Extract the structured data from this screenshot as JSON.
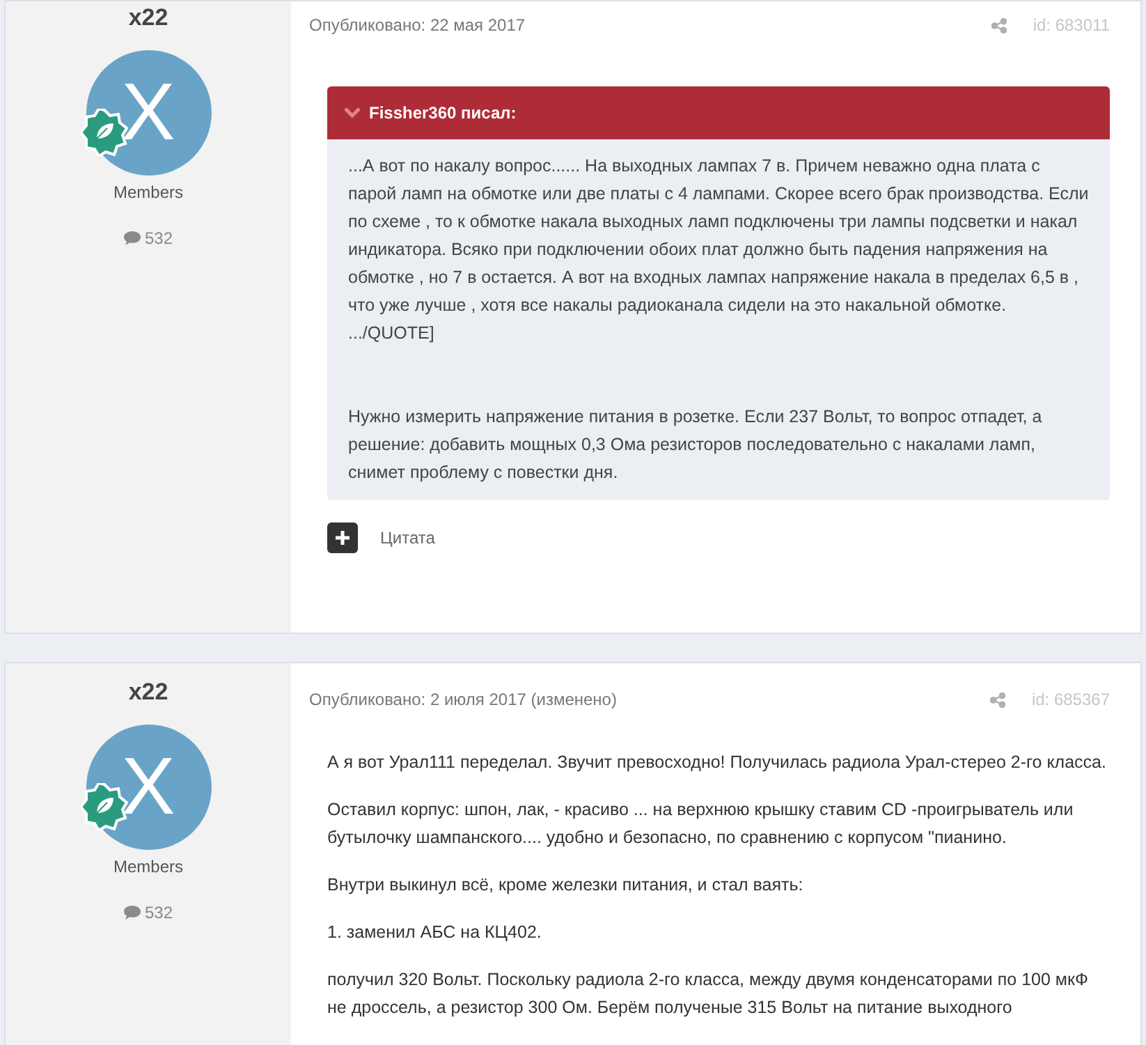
{
  "posts": [
    {
      "author": "x22",
      "avatar_letter": "X",
      "group": "Members",
      "post_count": "532",
      "published": "Опубликовано: 22 мая 2017",
      "post_id": "id: 683011",
      "quote": {
        "header": "Fissher360 писал:",
        "paragraphs": [
          "...А вот по накалу вопрос...... На выходных лампах 7 в. Причем неважно одна плата с парой ламп на обмотке или две платы с 4 лампами. Скорее всего брак производства. Если по схеме , то к обмотке накала выходных ламп подключены три лампы подсветки и накал индикатора. Всяко при подключении обоих плат должно быть падения напряжения на обмотке , но 7 в остается. А вот на входных лампах напряжение накала в пределах 6,5 в , что уже лучше , хотя все накалы радиоканала сидели на это накальной обмотке.",
          ".../QUOTE]",
          "Нужно измерить напряжение питания в розетке. Если 237 Вольт, то вопрос отпадет, а решение: добавить мощных 0,3 Ома резисторов последовательно с накалами ламп, снимет проблему с повестки дня."
        ]
      },
      "quote_action": "Цитата"
    },
    {
      "author": "x22",
      "avatar_letter": "X",
      "group": "Members",
      "post_count": "532",
      "published": "Опубликовано: 2 июля 2017 (изменено)",
      "post_id": "id: 685367",
      "paragraphs": [
        "А я вот Урал111 переделал. Звучит превосходно! Получилась радиола Урал-стерео 2-го класса.",
        "Оставил корпус: шпон, лак, - красиво ... на верхнюю крышку ставим CD -проигрыватель или бутылочку шампанского.... удобно и безопасно, по сравнению с корпусом \"пианино.",
        "Внутри выкинул всё, кроме железки питания, и стал ваять:",
        "1. заменил АБС на КЦ402.",
        "получил 320 Вольт. Поскольку радиола 2-го класса, между двумя конденсаторами по 100 мкФ не дроссель, а резистор 300 Ом. Берём полученые 315 Вольт на питание выходного"
      ]
    }
  ]
}
